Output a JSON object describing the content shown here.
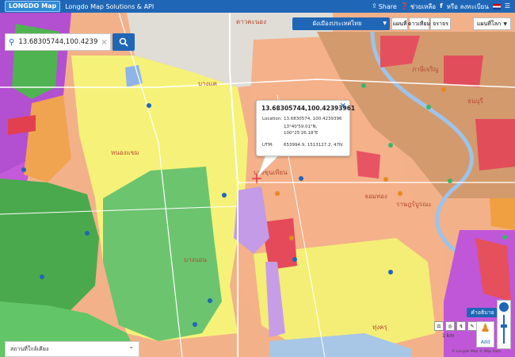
{
  "header": {
    "logo": "LONGDO Map",
    "product": "Longdo Map Solutions & API",
    "share": "Share",
    "help": "ช่วยเหลือ",
    "login": "หรือ ลงทะเบียน"
  },
  "search": {
    "value": "13.68305744,100.42393961"
  },
  "layers": {
    "selected": "ผังเมืองประเทศไทย",
    "map_button": "แผนที่",
    "traffic_button": "ดาวเทียม",
    "extra_button": "จราจร",
    "basemap_selected": "แผนที่โลก"
  },
  "popup": {
    "title": "13.68305744,100.42393961",
    "location_label": "Location:",
    "location_value": "13.6830574, 100.4239396",
    "dms_lat": "13°40'59.01\"N,",
    "dms_lon": "100°25'26.18\"E",
    "utm_label": "UTM:",
    "utm_value": "653994.9, 1513127.2, 47N"
  },
  "recent": {
    "label": "สถานที่ใกล้เคียง"
  },
  "controls": {
    "legend": "คำอธิบาย",
    "add_label": "Add",
    "scale": "1 km",
    "attribution": "© Longdo Map © Map data"
  },
  "map_labels": {
    "l1": "บางแค",
    "l2": "หนองแขม",
    "l3": "บางบอน",
    "l4": "ภาษีเจริญ",
    "l5": "จอมทอง",
    "l6": "ราษฎร์บูรณะ",
    "l7": "ทุ่งครุ",
    "l8": "บางขุนเทียน",
    "l9": "ธนบุรี",
    "l10": "ดาวคะนอง"
  },
  "colors": {
    "brand": "#1f67b6",
    "orange": "#f2a97c",
    "yellow": "#f8f37a",
    "green": "#6fbf73",
    "red": "#e84b58",
    "purple": "#b663d8",
    "brown": "#cf9569"
  }
}
